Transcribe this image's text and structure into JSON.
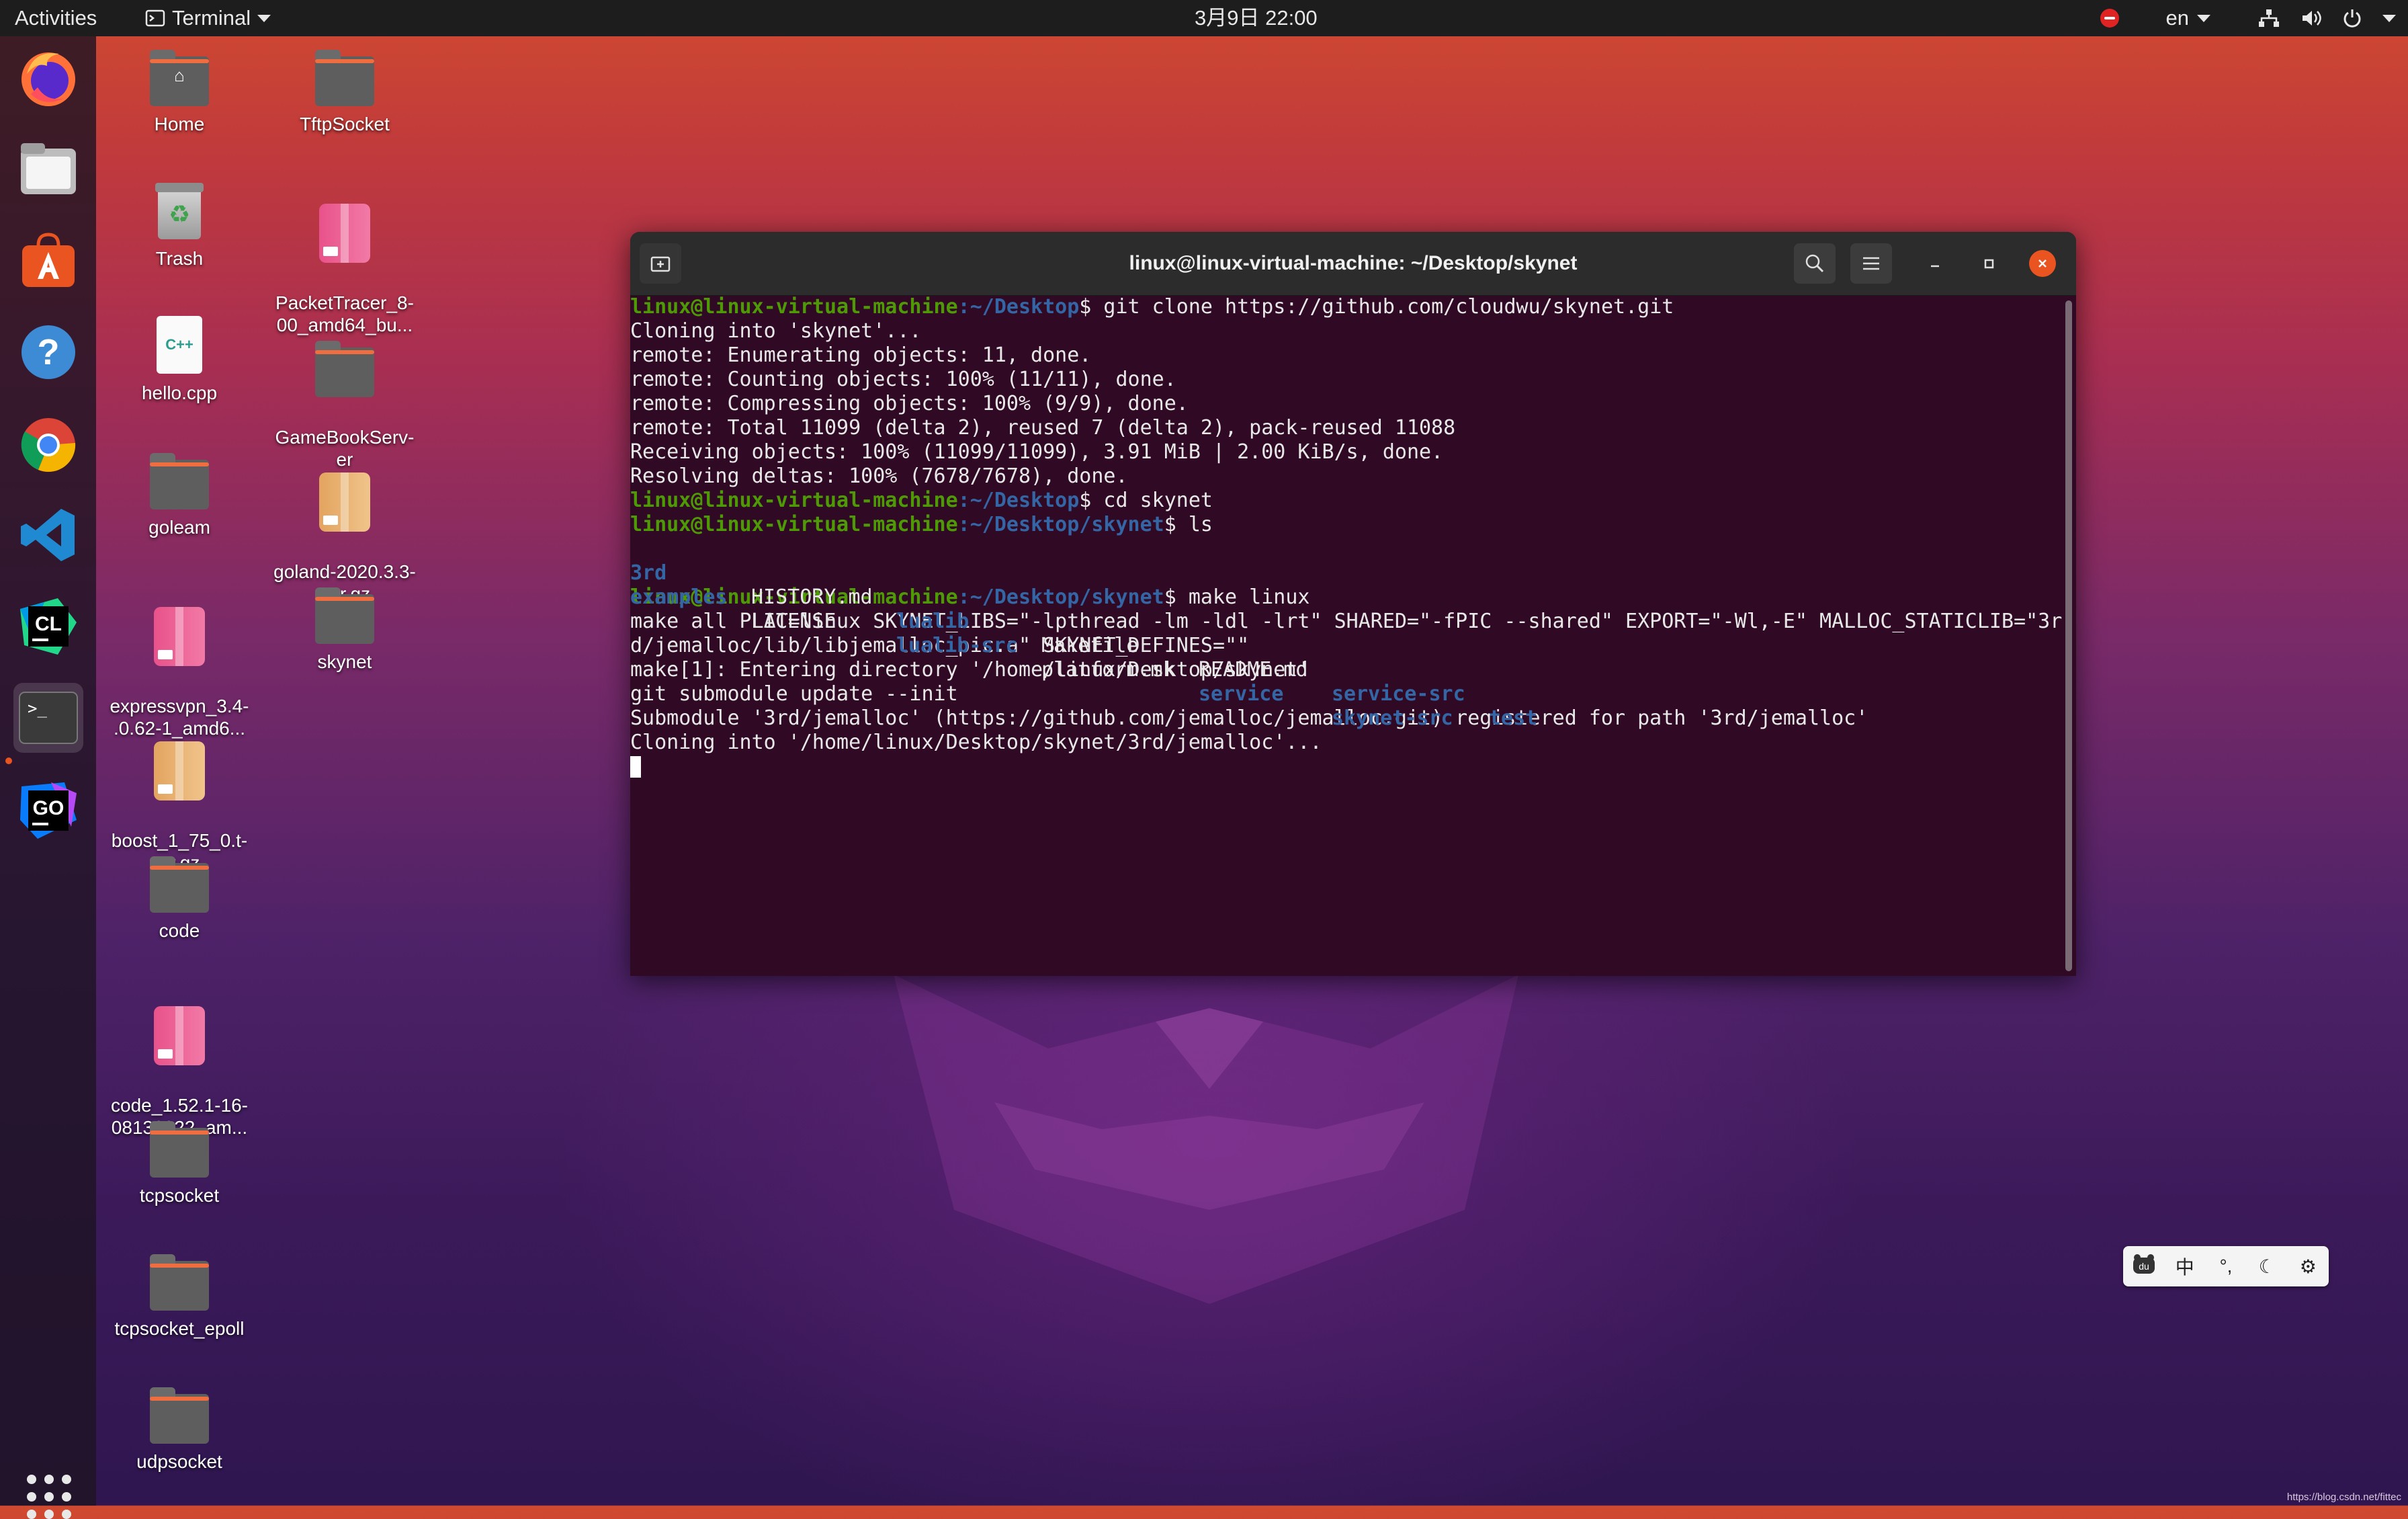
{
  "topbar": {
    "activities": "Activities",
    "app_name": "Terminal",
    "clock": "3月9日  22:00",
    "lang": "en"
  },
  "dock": {
    "items": [
      "firefox-icon",
      "files-icon",
      "software-icon",
      "help-icon",
      "chrome-icon",
      "vscode-icon",
      "clion-icon",
      "terminal-icon",
      "goland-icon"
    ],
    "clion_text": "CL",
    "goland_text": "GO",
    "terminal_text": ">_"
  },
  "desktop": {
    "col1": [
      "Home",
      "Trash",
      "hello.cpp",
      "goleam",
      "expressvpn_3.4-\n.0.62-1_amd6...",
      "boost_1_75_0.t-\nar.gz",
      "code",
      "code_1.52.1-16-\n08136922_am...",
      "tcpsocket",
      "tcpsocket_epoll",
      "udpsocket"
    ],
    "col2": [
      "TftpSocket",
      "PacketTracer_8-\n00_amd64_bu...",
      "GameBookServ-\ner",
      "goland-2020.3.3-\n.tar.gz",
      "skynet"
    ],
    "cpp_badge": "C++"
  },
  "terminal": {
    "title": "linux@linux-virtual-machine: ~/Desktop/skynet",
    "prompt_user": "linux@linux-virtual-machine",
    "cmd1_path": ":~/Desktop",
    "cmd1": "$ git clone https://github.com/cloudwu/skynet.git",
    "out1": [
      "Cloning into 'skynet'...",
      "remote: Enumerating objects: 11, done.",
      "remote: Counting objects: 100% (11/11), done.",
      "remote: Compressing objects: 100% (9/9), done.",
      "remote: Total 11099 (delta 2), reused 7 (delta 2), pack-reused 11088",
      "Receiving objects: 100% (11099/11099), 3.91 MiB | 2.00 KiB/s, done.",
      "Resolving deltas: 100% (7678/7678), done."
    ],
    "cmd2_path": ":~/Desktop",
    "cmd2": "$ cd skynet",
    "cmd3_path": ":~/Desktop/skynet",
    "cmd3": "$ ls",
    "ls": {
      "r1": [
        "3rd",
        "HISTORY.md",
        "lualib",
        "Makefile",
        "README.md",
        "service-src",
        "test"
      ],
      "r2": [
        "examples",
        "LICENSE",
        "lualib-src",
        "platform.mk",
        "service",
        "skynet-src"
      ]
    },
    "cmd4_path": ":~/Desktop/skynet",
    "cmd4": "$ make linux",
    "out2": [
      "make all PLAT=linux SKYNET_LIBS=\"-lpthread -lm -ldl -lrt\" SHARED=\"-fPIC --shared\" EXPORT=\"-Wl,-E\" MALLOC_STATICLIB=\"3r",
      "d/jemalloc/lib/libjemalloc_pic.a\" SKYNET_DEFINES=\"\"",
      "make[1]: Entering directory '/home/linux/Desktop/skynet'",
      "git submodule update --init",
      "Submodule '3rd/jemalloc' (https://github.com/jemalloc/jemalloc.git) registered for path '3rd/jemalloc'",
      "Cloning into '/home/linux/Desktop/skynet/3rd/jemalloc'..."
    ]
  },
  "ime": {
    "zh": "中",
    "punct": "°,"
  },
  "watermark": "https://blog.csdn.net/fittec"
}
